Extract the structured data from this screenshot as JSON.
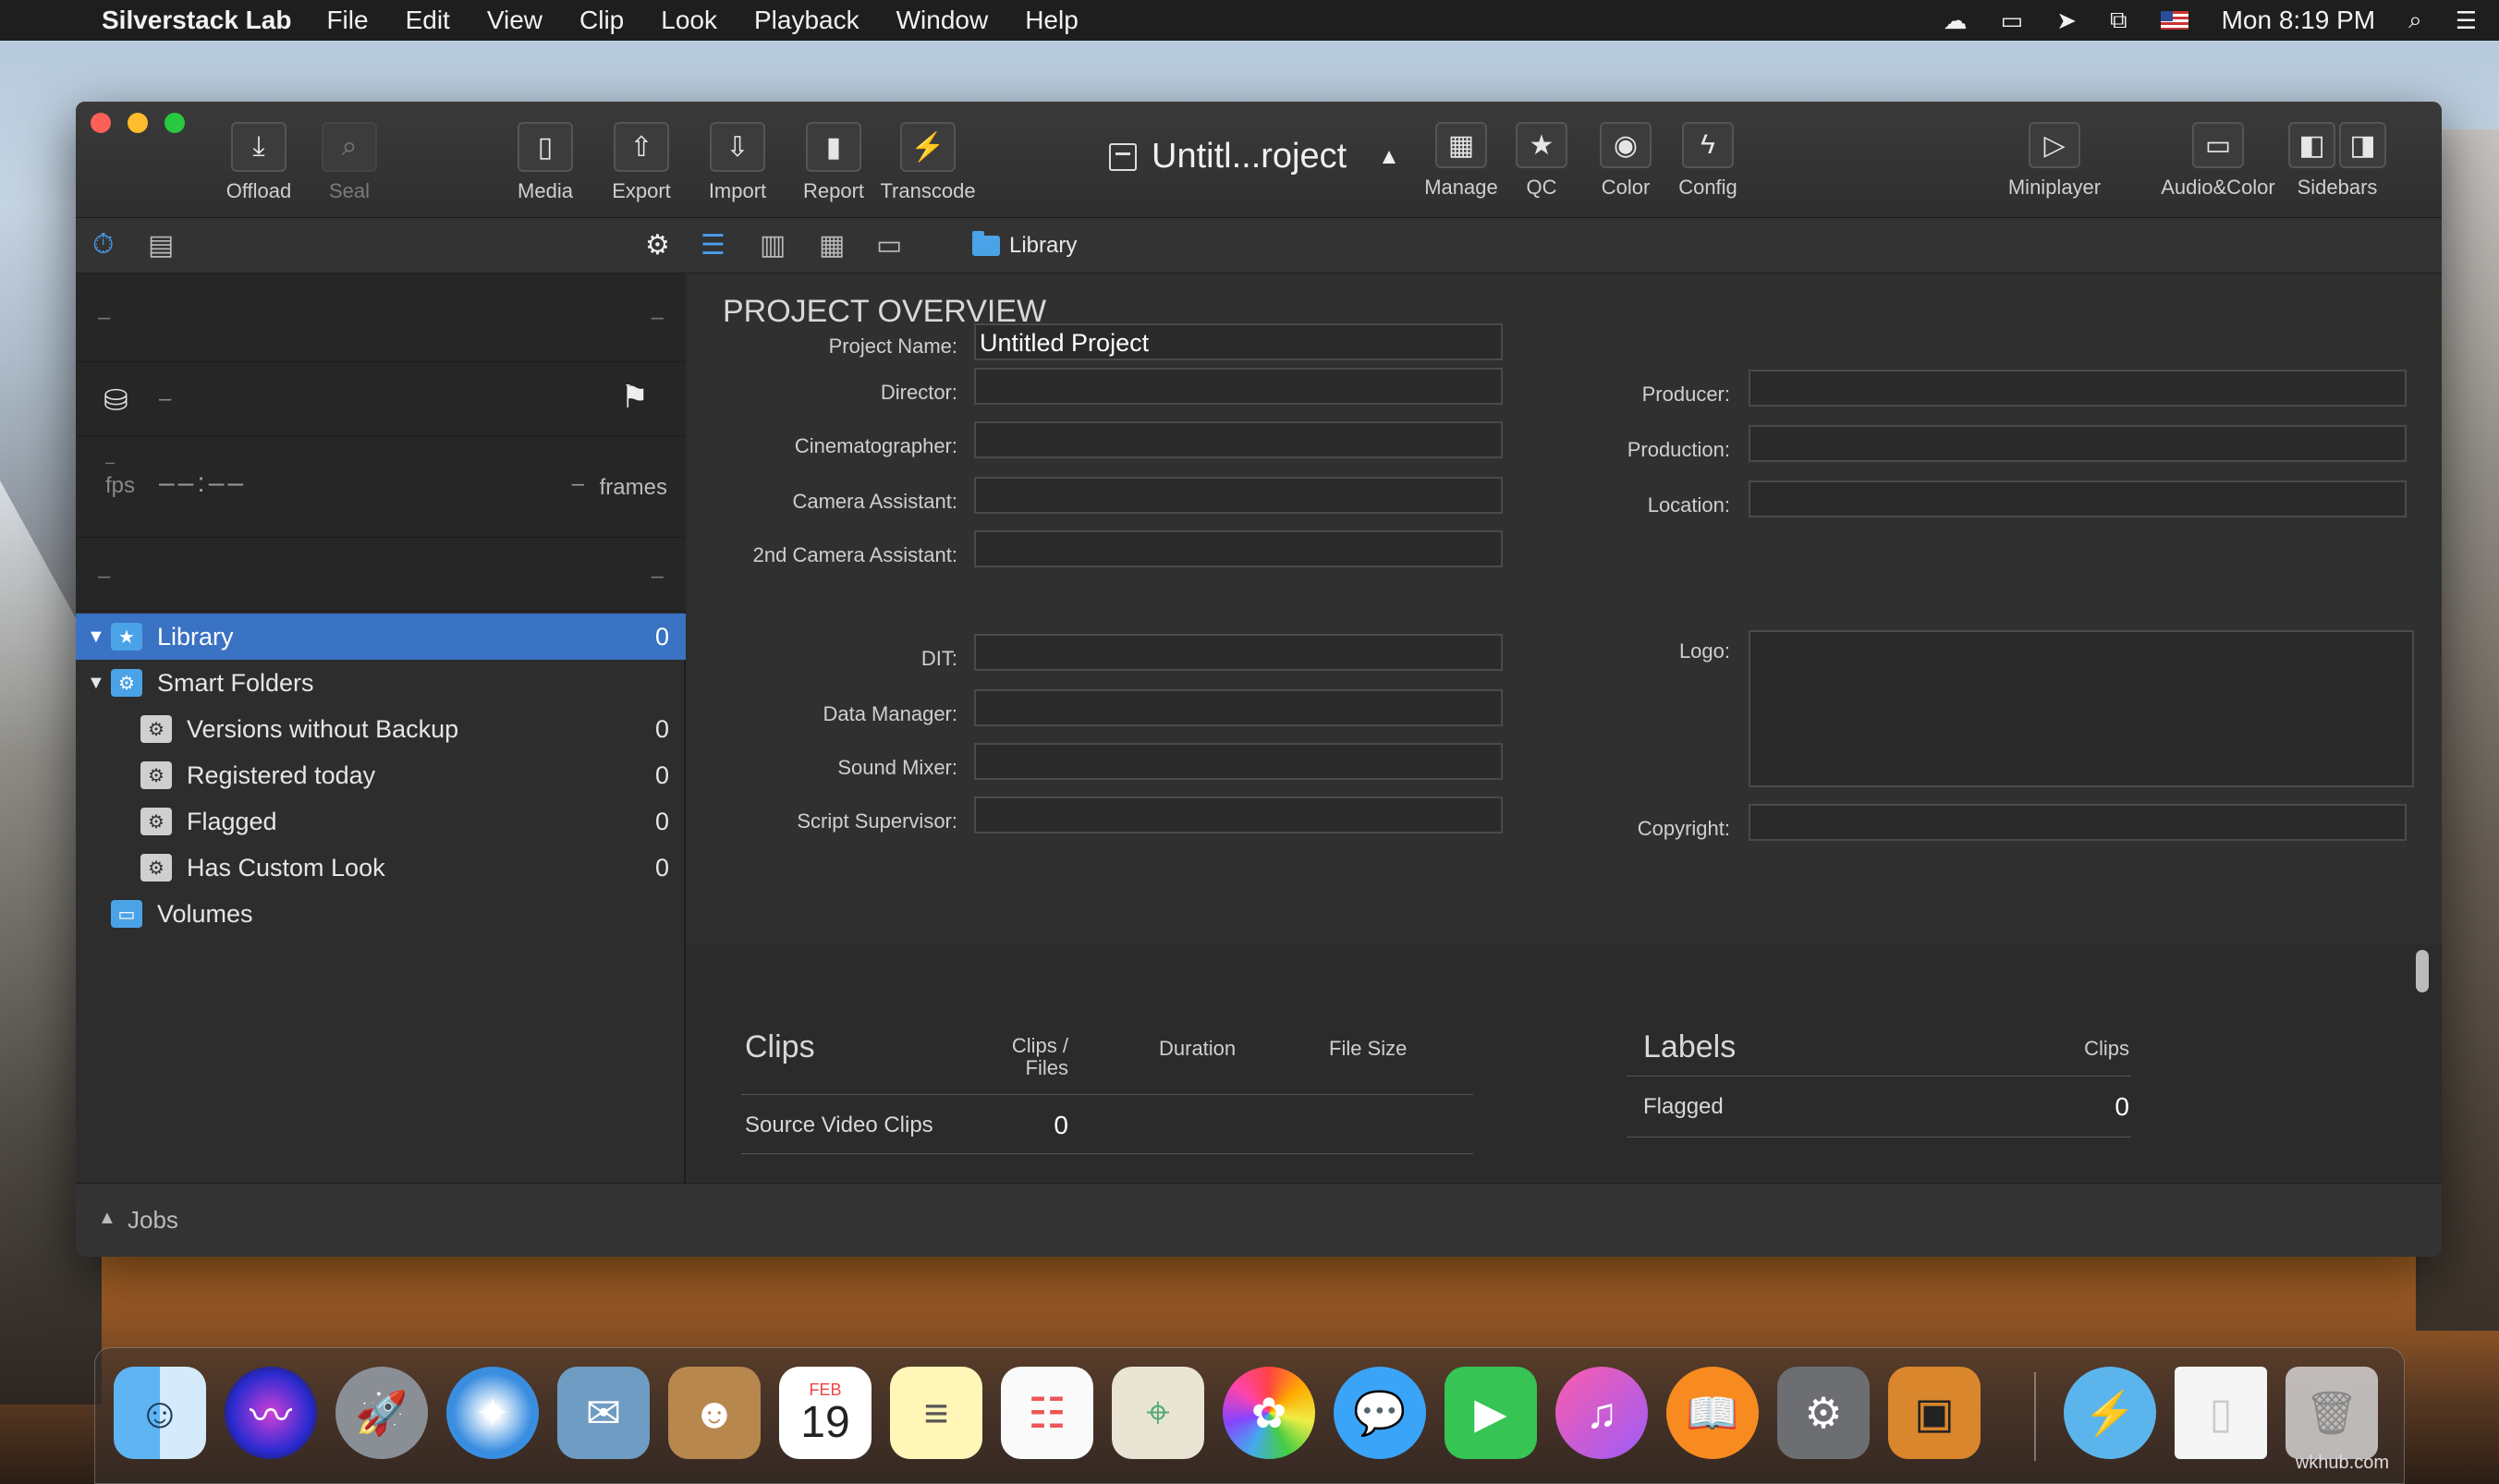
{
  "menubar": {
    "app": "Silverstack Lab",
    "items": [
      "File",
      "Edit",
      "View",
      "Clip",
      "Look",
      "Playback",
      "Window",
      "Help"
    ],
    "clock": "Mon 8:19 PM",
    "status_icons": [
      "creative-cloud-icon",
      "airplay-display-icon",
      "location-icon",
      "display-mirror-icon",
      "us-flag-icon",
      "spotlight-search-icon",
      "notification-center-icon"
    ]
  },
  "toolbar": {
    "offload": "Offload",
    "seal": "Seal",
    "media": "Media",
    "export": "Export",
    "import": "Import",
    "report": "Report",
    "transcode": "Transcode",
    "project_title": "Untitl...roject",
    "manage": "Manage",
    "qc": "QC",
    "color": "Color",
    "config": "Config",
    "miniplayer": "Miniplayer",
    "audio_color": "Audio&Color",
    "sidebars": "Sidebars"
  },
  "breadcrumb": {
    "label": "Library"
  },
  "sidebar": {
    "band1_left": "–",
    "band1_right": "–",
    "band2_text": "–",
    "fps_value": "–",
    "fps_label": "fps",
    "timecode": "––:––",
    "frames_value": "–",
    "frames_label": "frames",
    "band4_left": "–",
    "band4_right": "–",
    "tree": [
      {
        "label": "Library",
        "count": "0"
      },
      {
        "label": "Smart Folders",
        "count": ""
      },
      {
        "label": "Versions without Backup",
        "count": "0"
      },
      {
        "label": "Registered today",
        "count": "0"
      },
      {
        "label": "Flagged",
        "count": "0"
      },
      {
        "label": "Has Custom Look",
        "count": "0"
      },
      {
        "label": "Volumes",
        "count": ""
      }
    ]
  },
  "overview": {
    "heading": "PROJECT OVERVIEW",
    "project_name_label": "Project Name:",
    "project_name_value": "Untitled Project",
    "director": "Director:",
    "cinematographer": "Cinematographer:",
    "camera_assistant": "Camera Assistant:",
    "second_camera_assistant": "2nd Camera Assistant:",
    "dit": "DIT:",
    "data_manager": "Data Manager:",
    "sound_mixer": "Sound Mixer:",
    "script_supervisor": "Script Supervisor:",
    "producer": "Producer:",
    "production": "Production:",
    "location": "Location:",
    "logo": "Logo:",
    "copyright": "Copyright:"
  },
  "clips_table": {
    "title": "Clips",
    "col_clips_files_1": "Clips /",
    "col_clips_files_2": "Files",
    "col_duration": "Duration",
    "col_file_size": "File Size",
    "row_label": "Source Video Clips",
    "row_value": "0"
  },
  "labels_table": {
    "title": "Labels",
    "col_clips": "Clips",
    "row_label": "Flagged",
    "row_value": "0"
  },
  "jobs": {
    "label": "Jobs"
  },
  "dock": {
    "calendar_month": "FEB",
    "calendar_day": "19",
    "watermark": "wkhub.com"
  }
}
